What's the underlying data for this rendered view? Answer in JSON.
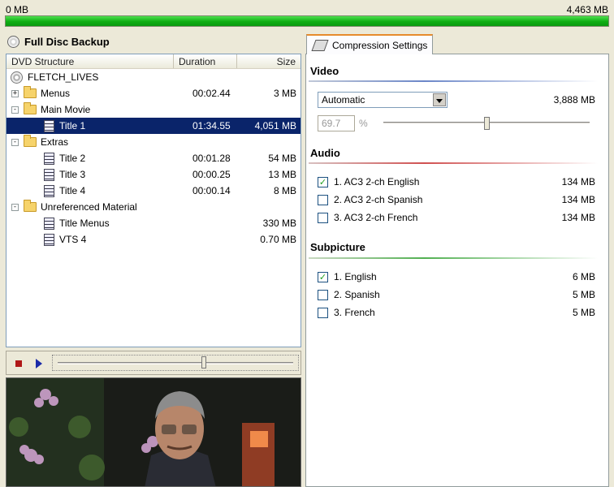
{
  "capacity": {
    "left_label": "0 MB",
    "right_label": "4,463 MB",
    "fill_fraction": 1.0,
    "fill_color": "#18b418"
  },
  "left": {
    "title": "Full Disc Backup",
    "columns": {
      "name": "DVD Structure",
      "duration": "Duration",
      "size": "Size"
    },
    "rows": [
      {
        "name": "FLETCH_LIVES",
        "duration": "",
        "size": "",
        "icon": "disc-icon",
        "expander": "",
        "indent": 0,
        "selected": false
      },
      {
        "name": "Menus",
        "duration": "00:02.44",
        "size": "3 MB",
        "icon": "folder-icon",
        "expander": "+",
        "indent": 0,
        "selected": false
      },
      {
        "name": "Main Movie",
        "duration": "",
        "size": "",
        "icon": "folder-icon",
        "expander": "−",
        "indent": 0,
        "selected": false
      },
      {
        "name": "Title 1",
        "duration": "01:34.55",
        "size": "4,051 MB",
        "icon": "film-icon",
        "expander": "",
        "indent": 1,
        "selected": true
      },
      {
        "name": "Extras",
        "duration": "",
        "size": "",
        "icon": "folder-icon",
        "expander": "−",
        "indent": 0,
        "selected": false
      },
      {
        "name": "Title 2",
        "duration": "00:01.28",
        "size": "54 MB",
        "icon": "film-icon",
        "expander": "",
        "indent": 1,
        "selected": false
      },
      {
        "name": "Title 3",
        "duration": "00:00.25",
        "size": "13 MB",
        "icon": "film-icon",
        "expander": "",
        "indent": 1,
        "selected": false
      },
      {
        "name": "Title 4",
        "duration": "00:00.14",
        "size": "8 MB",
        "icon": "film-icon",
        "expander": "",
        "indent": 1,
        "selected": false
      },
      {
        "name": "Unreferenced Material",
        "duration": "",
        "size": "",
        "icon": "folder-icon",
        "expander": "−",
        "indent": 0,
        "selected": false
      },
      {
        "name": "Title Menus",
        "duration": "",
        "size": "330 MB",
        "icon": "film-icon",
        "expander": "",
        "indent": 1,
        "selected": false
      },
      {
        "name": "VTS 4",
        "duration": "",
        "size": "0.70 MB",
        "icon": "film-icon",
        "expander": "",
        "indent": 1,
        "selected": false
      }
    ]
  },
  "player": {
    "seek_fraction": 0.62
  },
  "compression": {
    "tab_label": "Compression Settings",
    "video": {
      "heading": "Video",
      "mode": "Automatic",
      "size": "3,888 MB",
      "percent_value": "69.7",
      "percent_sign": "%",
      "slider_fraction": 0.5
    },
    "audio": {
      "heading": "Audio",
      "tracks": [
        {
          "label": "1. AC3 2-ch English",
          "size": "134 MB",
          "checked": true
        },
        {
          "label": "2. AC3 2-ch Spanish",
          "size": "134 MB",
          "checked": false
        },
        {
          "label": "3. AC3 2-ch French",
          "size": "134 MB",
          "checked": false
        }
      ]
    },
    "subpicture": {
      "heading": "Subpicture",
      "tracks": [
        {
          "label": "1. English",
          "size": "6 MB",
          "checked": true
        },
        {
          "label": "2. Spanish",
          "size": "5 MB",
          "checked": false
        },
        {
          "label": "3. French",
          "size": "5 MB",
          "checked": false
        }
      ]
    }
  }
}
